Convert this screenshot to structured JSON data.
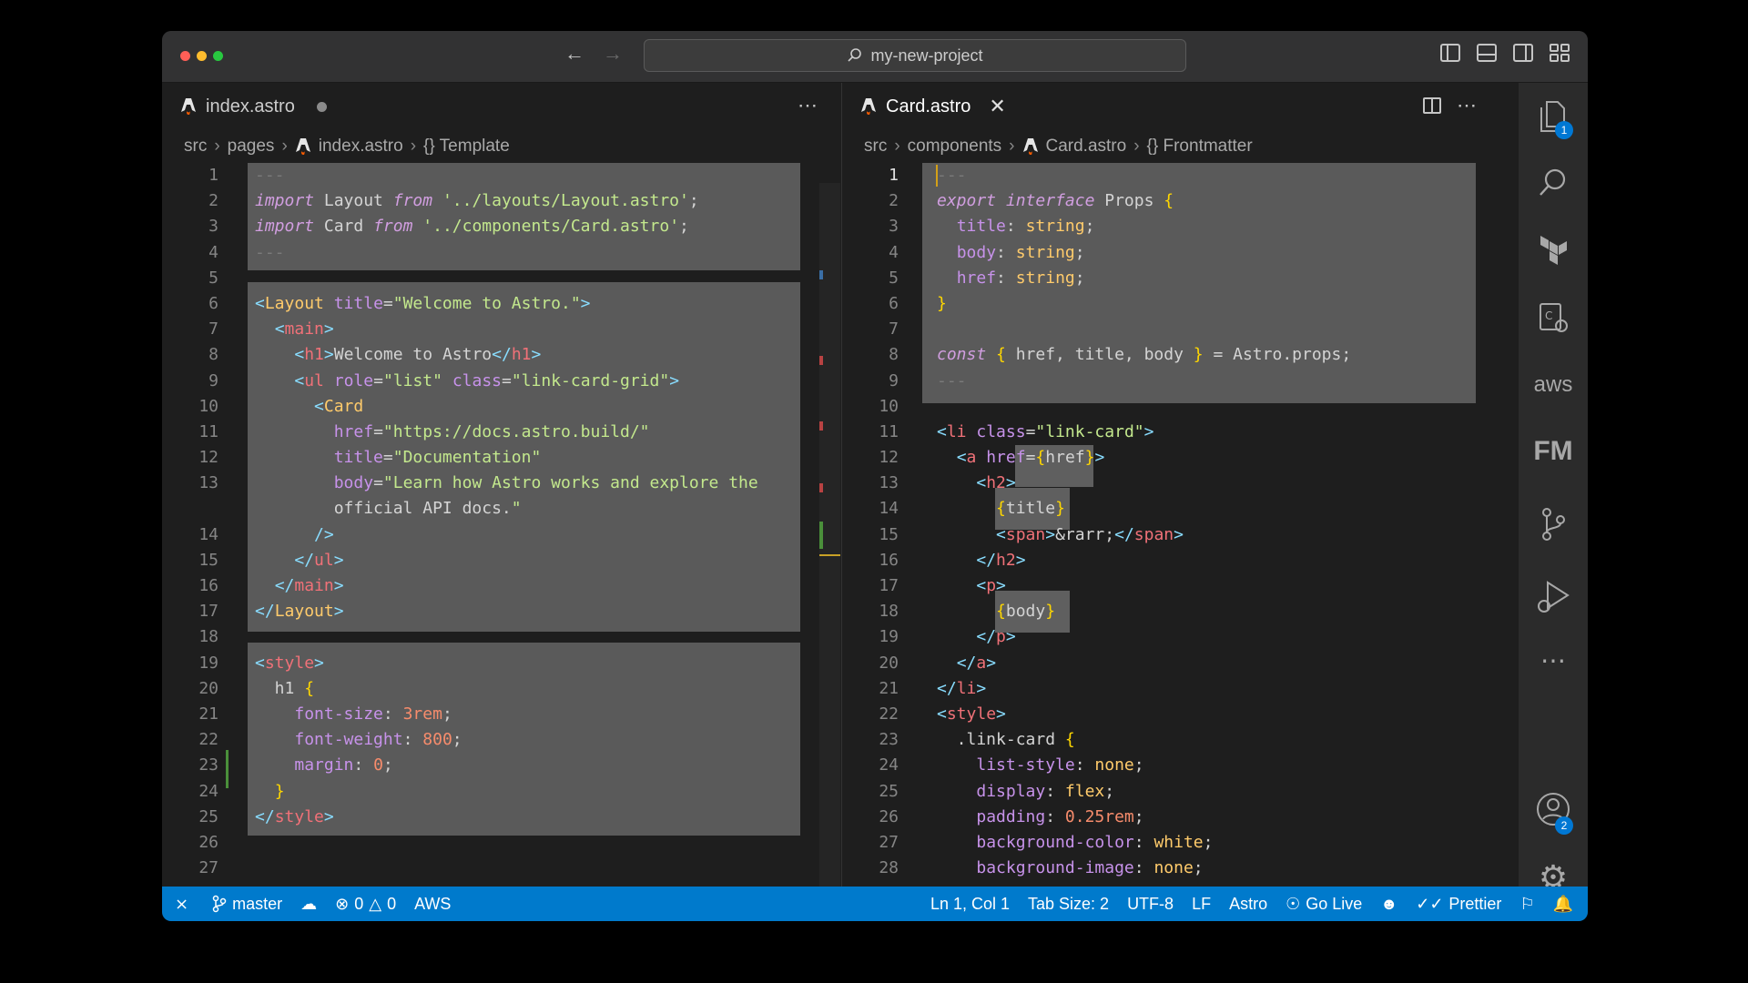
{
  "window": {
    "search": "my-new-project"
  },
  "left_editor": {
    "tab": {
      "name": "index.astro"
    },
    "breadcrumb": [
      "src",
      "pages",
      "index.astro",
      "{} Template"
    ],
    "lines": [
      {
        "n": "1",
        "t": "---"
      },
      {
        "n": "2",
        "t": "import Layout from '../layouts/Layout.astro';"
      },
      {
        "n": "3",
        "t": "import Card from '../components/Card.astro';"
      },
      {
        "n": "4",
        "t": "---"
      },
      {
        "n": "5",
        "t": ""
      },
      {
        "n": "6",
        "t": "<Layout title=\"Welcome to Astro.\">"
      },
      {
        "n": "7",
        "t": "  <main>"
      },
      {
        "n": "8",
        "t": "    <h1>Welcome to Astro</h1>"
      },
      {
        "n": "9",
        "t": "    <ul role=\"list\" class=\"link-card-grid\">"
      },
      {
        "n": "10",
        "t": "      <Card"
      },
      {
        "n": "11",
        "t": "        href=\"https://docs.astro.build/\""
      },
      {
        "n": "12",
        "t": "        title=\"Documentation\""
      },
      {
        "n": "13",
        "t": "        body=\"Learn how Astro works and explore the"
      },
      {
        "n": "",
        "t": "        official API docs.\""
      },
      {
        "n": "14",
        "t": "      />"
      },
      {
        "n": "15",
        "t": "    </ul>"
      },
      {
        "n": "16",
        "t": "  </main>"
      },
      {
        "n": "17",
        "t": "</Layout>"
      },
      {
        "n": "18",
        "t": ""
      },
      {
        "n": "19",
        "t": "<style>"
      },
      {
        "n": "20",
        "t": "  h1 {"
      },
      {
        "n": "21",
        "t": "    font-size: 3rem;"
      },
      {
        "n": "22",
        "t": "    font-weight: 800;"
      },
      {
        "n": "23",
        "t": "    margin: 0;"
      },
      {
        "n": "24",
        "t": "  }"
      },
      {
        "n": "25",
        "t": "</style>"
      },
      {
        "n": "26",
        "t": ""
      },
      {
        "n": "27",
        "t": ""
      }
    ]
  },
  "right_editor": {
    "tab": {
      "name": "Card.astro"
    },
    "breadcrumb": [
      "src",
      "components",
      "Card.astro",
      "{} Frontmatter"
    ],
    "lines": [
      {
        "n": "1",
        "t": "---"
      },
      {
        "n": "2",
        "t": "export interface Props {"
      },
      {
        "n": "3",
        "t": "  title: string;"
      },
      {
        "n": "4",
        "t": "  body: string;"
      },
      {
        "n": "5",
        "t": "  href: string;"
      },
      {
        "n": "6",
        "t": "}"
      },
      {
        "n": "7",
        "t": ""
      },
      {
        "n": "8",
        "t": "const { href, title, body } = Astro.props;"
      },
      {
        "n": "9",
        "t": "---"
      },
      {
        "n": "10",
        "t": ""
      },
      {
        "n": "11",
        "t": "<li class=\"link-card\">"
      },
      {
        "n": "12",
        "t": "  <a href={href}>"
      },
      {
        "n": "13",
        "t": "    <h2>"
      },
      {
        "n": "14",
        "t": "      {title}"
      },
      {
        "n": "15",
        "t": "      <span>&rarr;</span>"
      },
      {
        "n": "16",
        "t": "    </h2>"
      },
      {
        "n": "17",
        "t": "    <p>"
      },
      {
        "n": "18",
        "t": "      {body}"
      },
      {
        "n": "19",
        "t": "    </p>"
      },
      {
        "n": "20",
        "t": "  </a>"
      },
      {
        "n": "21",
        "t": "</li>"
      },
      {
        "n": "22",
        "t": "<style>"
      },
      {
        "n": "23",
        "t": "  .link-card {"
      },
      {
        "n": "24",
        "t": "    list-style: none;"
      },
      {
        "n": "25",
        "t": "    display: flex;"
      },
      {
        "n": "26",
        "t": "    padding: 0.25rem;"
      },
      {
        "n": "27",
        "t": "    background-color: white;"
      },
      {
        "n": "28",
        "t": "    background-image: none;"
      }
    ]
  },
  "activity_bar": {
    "icons": [
      "files-icon",
      "search-icon",
      "terraform-icon",
      "remote-explorer-icon",
      "aws-icon",
      "fm-icon",
      "source-control-icon",
      "run-debug-icon",
      "more-icon",
      "accounts-icon",
      "settings-icon"
    ],
    "files_badge": "1",
    "accounts_badge": "2",
    "aws_label": "aws",
    "fm_label": "FM"
  },
  "status_bar": {
    "branch": "master",
    "errors": "0",
    "warnings": "0",
    "aws": "AWS",
    "position": "Ln 1, Col 1",
    "tab_size": "Tab Size: 2",
    "encoding": "UTF-8",
    "eol": "LF",
    "language": "Astro",
    "go_live": "Go Live",
    "prettier": "Prettier"
  }
}
